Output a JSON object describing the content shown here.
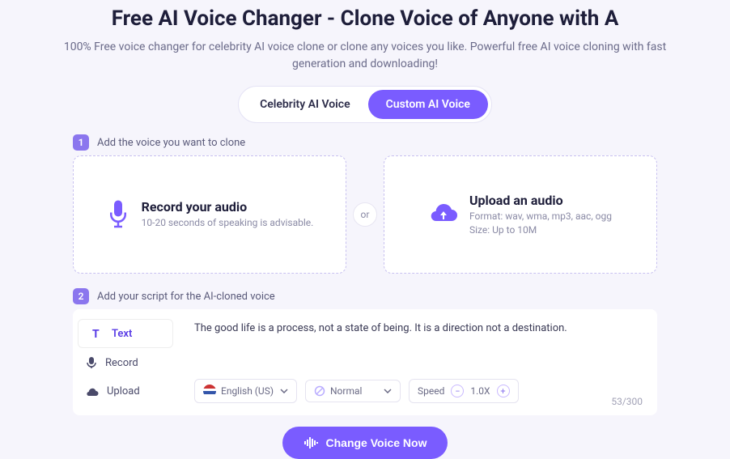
{
  "header": {
    "title": "Free AI Voice Changer - Clone Voice of Anyone with A",
    "subtitle": "100% Free voice changer for celebrity AI voice clone or clone any voices you like. Powerful free AI voice cloning with fast generation and downloading!"
  },
  "tabs": {
    "celebrity": "Celebrity AI Voice",
    "custom": "Custom AI Voice"
  },
  "step1": {
    "label": "Add the voice you want to clone",
    "number": "1",
    "record": {
      "title": "Record your audio",
      "subtitle": "10-20 seconds of speaking is advisable."
    },
    "upload": {
      "title": "Upload an audio",
      "line1": "Format: wav, wma, mp3, aac, ogg",
      "line2": "Size: Up to 10M"
    },
    "or": "or"
  },
  "step2": {
    "label": "Add your script for the AI-cloned voice",
    "number": "2",
    "tabs": {
      "text": "Text",
      "record": "Record",
      "upload": "Upload"
    },
    "script_text": "The good life is a process, not a state of being. It is a direction not a destination.",
    "language": "English  (US)",
    "normal": "Normal",
    "speed_label": "Speed",
    "speed_value": "1.0X",
    "char_count": "53/300"
  },
  "cta": {
    "label": "Change Voice Now"
  }
}
